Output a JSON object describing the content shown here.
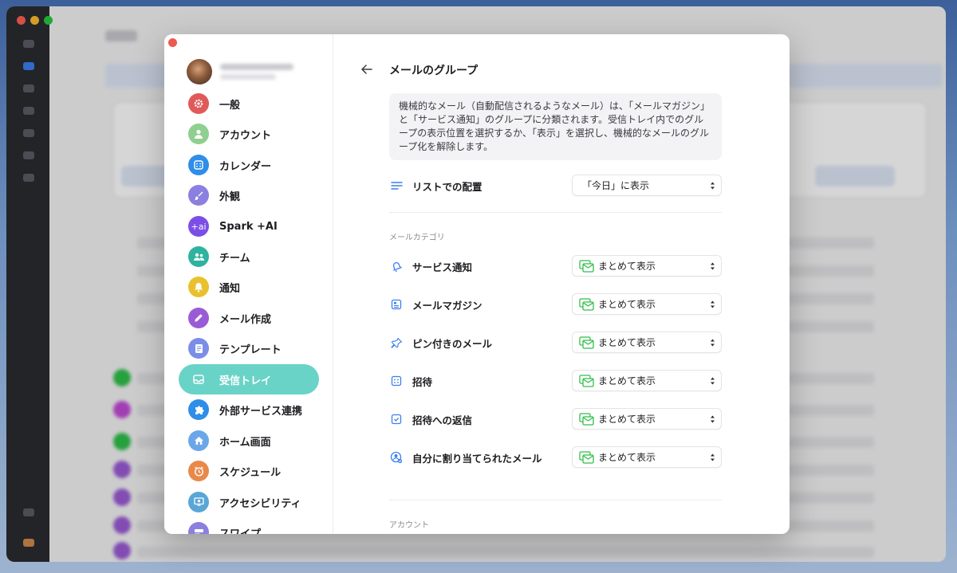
{
  "modal": {
    "title": "メールのグループ",
    "description": "機械的なメール（自動配信されるようなメール）は、「メールマガジン」と「サービス通知」のグループに分類されます。受信トレイ内でのグループの表示位置を選択するか、「表示」を選択し、機械的なメールのグループ化を解除します。",
    "list_placement": {
      "label": "リストでの配置",
      "value": "「今日」に表示"
    },
    "categories_header": "メールカテゴリ",
    "categories": [
      {
        "label": "サービス通知",
        "value": "まとめて表示",
        "icon": "bell-outline-icon"
      },
      {
        "label": "メールマガジン",
        "value": "まとめて表示",
        "icon": "newsletter-icon"
      },
      {
        "label": "ピン付きのメール",
        "value": "まとめて表示",
        "icon": "pin-icon"
      },
      {
        "label": "招待",
        "value": "まとめて表示",
        "icon": "calendar-icon"
      },
      {
        "label": "招待への返信",
        "value": "まとめて表示",
        "icon": "calendar-check-icon"
      },
      {
        "label": "自分に割り当てられたメール",
        "value": "まとめて表示",
        "icon": "assigned-icon"
      }
    ],
    "account_header": "アカウント"
  },
  "sidebar": {
    "items": [
      {
        "label": "一般",
        "icon": "gear-icon",
        "color": "#e05a5a"
      },
      {
        "label": "アカウント",
        "icon": "person-icon",
        "color": "#8fcf8f"
      },
      {
        "label": "カレンダー",
        "icon": "calendar-icon",
        "color": "#2e8ee8"
      },
      {
        "label": "外観",
        "icon": "brush-icon",
        "color": "#8b7fe0"
      },
      {
        "label": "Spark +AI",
        "icon": "ai-icon",
        "color": "#7b4fe6"
      },
      {
        "label": "チーム",
        "icon": "team-icon",
        "color": "#2fb3a0"
      },
      {
        "label": "通知",
        "icon": "bell-icon",
        "color": "#e8c12c"
      },
      {
        "label": "メール作成",
        "icon": "pencil-icon",
        "color": "#9b5bd6"
      },
      {
        "label": "テンプレート",
        "icon": "template-icon",
        "color": "#7a8ee8"
      },
      {
        "label": "受信トレイ",
        "icon": "inbox-icon",
        "color": "#6ad3c7",
        "active": true
      },
      {
        "label": "外部サービス連携",
        "icon": "puzzle-icon",
        "color": "#2e8ee8"
      },
      {
        "label": "ホーム画面",
        "icon": "home-icon",
        "color": "#6aa7e8"
      },
      {
        "label": "スケジュール",
        "icon": "clock-icon",
        "color": "#e8894a"
      },
      {
        "label": "アクセシビリティ",
        "icon": "accessibility-icon",
        "color": "#5aa6d6"
      },
      {
        "label": "スワイプ",
        "icon": "swipe-icon",
        "color": "#8b7fe0"
      }
    ]
  },
  "colors": {
    "accent": "#6ad3c7",
    "close": "#ec5b52"
  }
}
